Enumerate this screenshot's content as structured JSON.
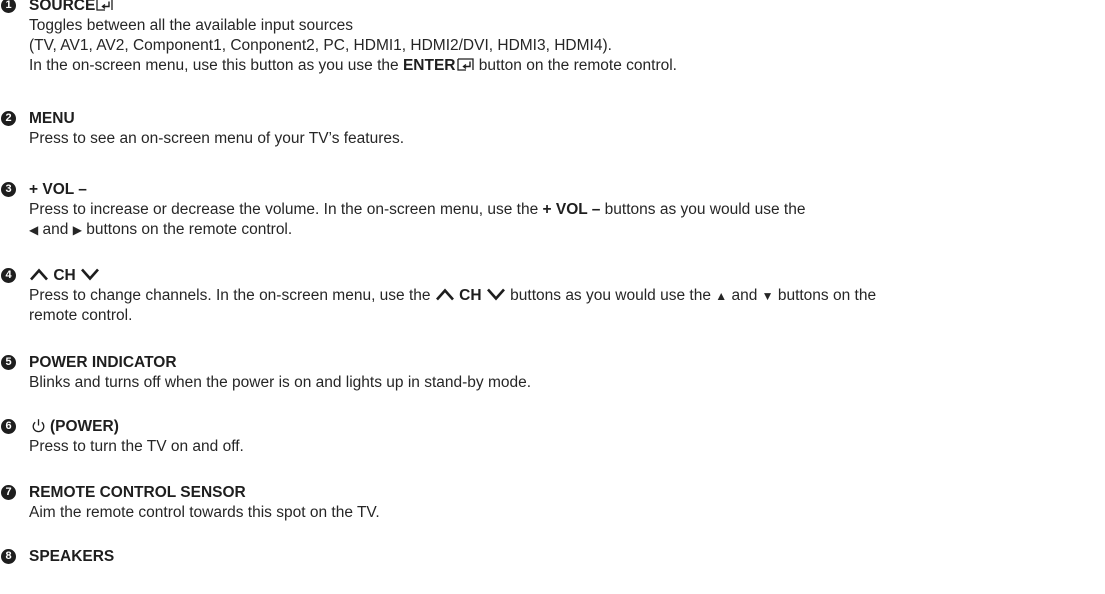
{
  "items": [
    {
      "number": "1",
      "title": "SOURCE",
      "lines": [
        "Toggles between all the available input sources",
        "(TV, AV1, AV2, Component1, Conponent2, PC, HDMI1, HDMI2/DVI, HDMI3, HDMI4)."
      ],
      "line3_prefix": "In the on-screen menu, use this button as you use the ",
      "line3_bold": "ENTER",
      "line3_suffix": " button on the remote control."
    },
    {
      "number": "2",
      "title": "MENU",
      "lines": [
        "Press to see an on-screen menu of your TV’s features."
      ]
    },
    {
      "number": "3",
      "title": "+ VOL –",
      "line1_prefix": "Press to increase or decrease the volume. In the on-screen menu, use the ",
      "line1_bold": "+ VOL –",
      "line1_suffix": " buttons as you would use the",
      "line2_left_glyph": "◀",
      "line2_mid": " and ",
      "line2_right_glyph": "▶",
      "line2_suffix": " buttons on the remote control."
    },
    {
      "number": "4",
      "title": "CH",
      "line1_prefix": "Press to change channels. In the on-screen menu, use the ",
      "line1_bold": "CH",
      "line1_mid": " buttons as you would use the ",
      "line1_up_glyph": "▲",
      "line1_and": " and ",
      "line1_down_glyph": "▼",
      "line1_suffix": " buttons on the",
      "line2": "remote control."
    },
    {
      "number": "5",
      "title": "POWER INDICATOR",
      "lines": [
        "Blinks and turns off when the power is on and lights up in stand-by mode."
      ]
    },
    {
      "number": "6",
      "title": "(POWER)",
      "lines": [
        "Press to turn the TV on and off."
      ]
    },
    {
      "number": "7",
      "title": "REMOTE CONTROL SENSOR",
      "lines": [
        "Aim the remote control towards this spot on the TV."
      ]
    },
    {
      "number": "8",
      "title": "SPEAKERS",
      "lines": []
    }
  ]
}
